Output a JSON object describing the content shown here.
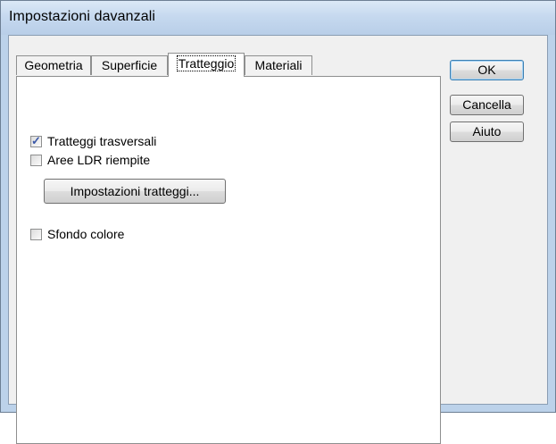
{
  "window": {
    "title": "Impostazioni davanzali"
  },
  "tabs": [
    {
      "label": "Geometria",
      "active": false
    },
    {
      "label": "Superficie",
      "active": false
    },
    {
      "label": "Tratteggio",
      "active": true
    },
    {
      "label": "Materiali",
      "active": false
    }
  ],
  "panel": {
    "checkboxes": [
      {
        "label": "Tratteggi trasversali",
        "checked": true
      },
      {
        "label": "Aree LDR riempite",
        "checked": false
      },
      {
        "label": "Sfondo colore",
        "checked": false
      }
    ],
    "hatch_settings_button": "Impostazioni tratteggi..."
  },
  "buttons": {
    "ok": "OK",
    "cancel": "Cancella",
    "help": "Aiuto"
  }
}
